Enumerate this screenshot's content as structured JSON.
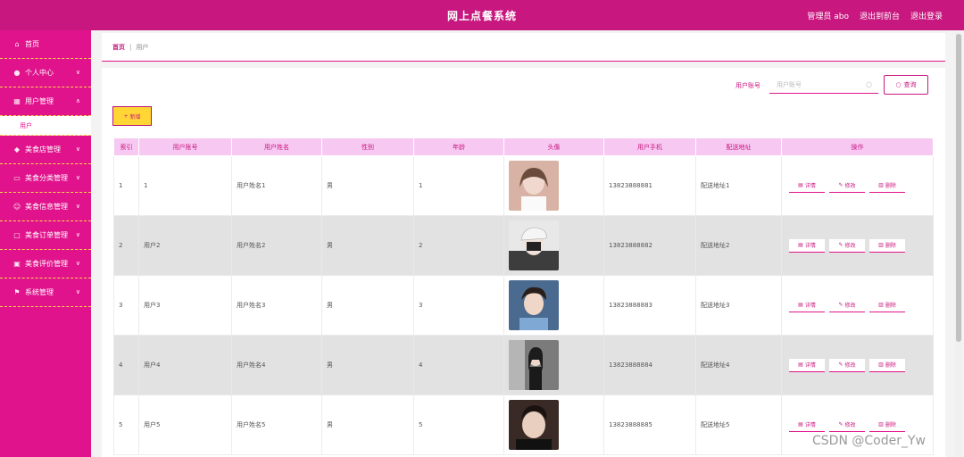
{
  "header": {
    "title": "网上点餐系统",
    "admin": "管理员 abo",
    "back_front": "退出到前台",
    "logout": "退出登录"
  },
  "sidebar": {
    "items": [
      {
        "label": "首页",
        "icon": "home-icon",
        "expandable": false
      },
      {
        "label": "个人中心",
        "icon": "user-icon",
        "expandable": true
      },
      {
        "label": "用户管理",
        "icon": "users-icon",
        "expandable": true,
        "expanded": true,
        "submenu": [
          "用户"
        ]
      },
      {
        "label": "美食店管理",
        "icon": "shield-icon",
        "expandable": true
      },
      {
        "label": "美食分类管理",
        "icon": "list-icon",
        "expandable": true
      },
      {
        "label": "美食信息管理",
        "icon": "info-icon",
        "expandable": true
      },
      {
        "label": "美食订单管理",
        "icon": "order-icon",
        "expandable": true
      },
      {
        "label": "美食评价管理",
        "icon": "comment-icon",
        "expandable": true
      },
      {
        "label": "系统管理",
        "icon": "flag-icon",
        "expandable": true
      }
    ]
  },
  "breadcrumb": {
    "home": "首页",
    "separator": "|",
    "current": "用户"
  },
  "search": {
    "label": "用户账号",
    "placeholder": "用户账号",
    "button": "查询"
  },
  "toolbar": {
    "add_label": "新增"
  },
  "table": {
    "columns": [
      "索引",
      "用户账号",
      "用户姓名",
      "性别",
      "年龄",
      "头像",
      "用户手机",
      "配送地址",
      "操作"
    ],
    "rows": [
      {
        "index": "1",
        "account": "1",
        "name": "用户姓名1",
        "gender": "男",
        "age": "1",
        "phone": "13823888881",
        "address": "配送地址1",
        "avatar_bg": "#d8b3a5"
      },
      {
        "index": "2",
        "account": "用户2",
        "name": "用户姓名2",
        "gender": "男",
        "age": "2",
        "phone": "13823888882",
        "address": "配送地址2",
        "avatar_bg": "#3d3d3d"
      },
      {
        "index": "3",
        "account": "用户3",
        "name": "用户姓名3",
        "gender": "男",
        "age": "3",
        "phone": "13823888883",
        "address": "配送地址3",
        "avatar_bg": "#4a6a8f"
      },
      {
        "index": "4",
        "account": "用户4",
        "name": "用户姓名4",
        "gender": "男",
        "age": "4",
        "phone": "13823888884",
        "address": "配送地址4",
        "avatar_bg": "#7b7b7b"
      },
      {
        "index": "5",
        "account": "用户5",
        "name": "用户姓名5",
        "gender": "男",
        "age": "5",
        "phone": "13823888885",
        "address": "配送地址5",
        "avatar_bg": "#3a2a26"
      }
    ],
    "actions": {
      "detail": "详情",
      "edit": "修改",
      "delete": "删除"
    }
  },
  "watermark": "CSDN @Coder_Yw",
  "colors": {
    "primary": "#c8177f",
    "sidebar": "#e0138c",
    "accent": "#ffd633",
    "header_row": "#f7c9f2"
  }
}
